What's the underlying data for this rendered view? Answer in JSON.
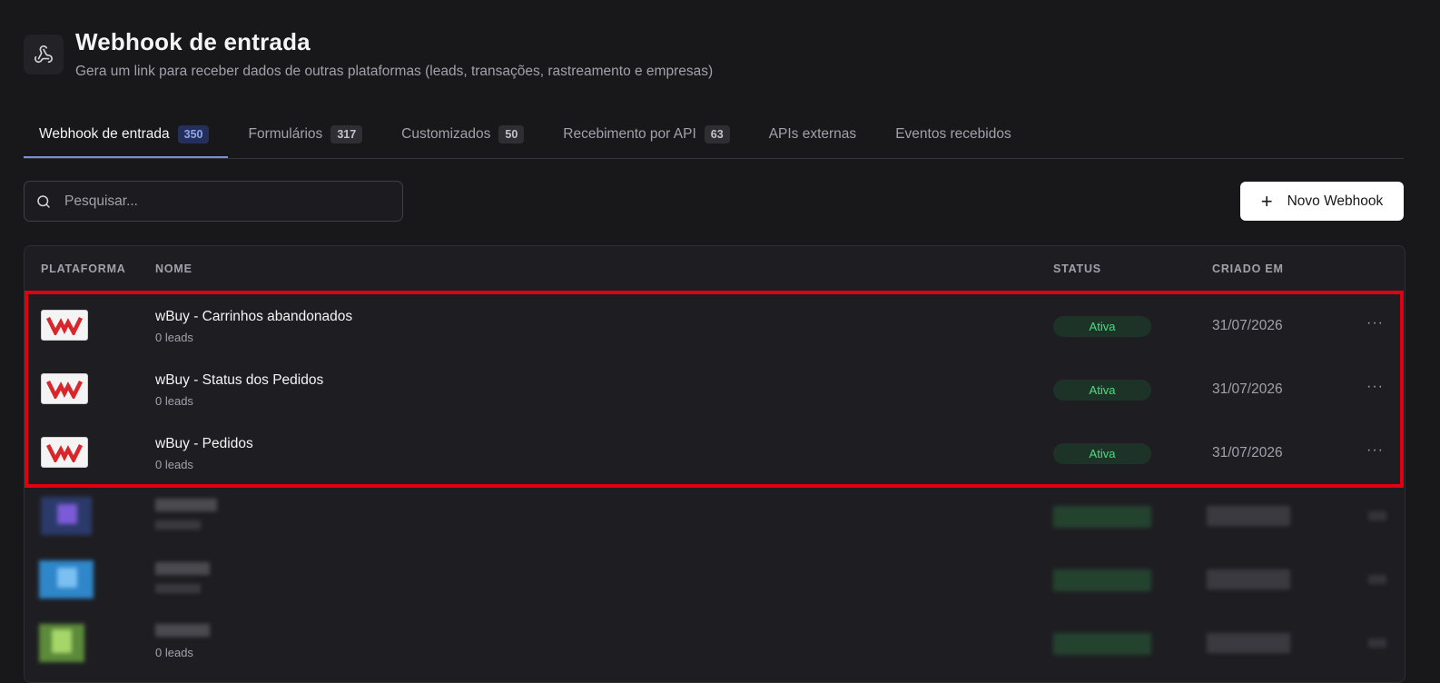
{
  "header": {
    "title": "Webhook de entrada",
    "subtitle": "Gera um link para receber dados de outras plataformas (leads, transações, rastreamento e empresas)",
    "icon": "webhook-icon"
  },
  "tabs": [
    {
      "label": "Webhook de entrada",
      "count": "350",
      "active": true
    },
    {
      "label": "Formulários",
      "count": "317"
    },
    {
      "label": "Customizados",
      "count": "50"
    },
    {
      "label": "Recebimento por API",
      "count": "63"
    },
    {
      "label": "APIs externas",
      "count": ""
    },
    {
      "label": "Eventos recebidos",
      "count": ""
    }
  ],
  "search": {
    "placeholder": "Pesquisar..."
  },
  "toolbar": {
    "new_label": "Novo Webhook"
  },
  "table": {
    "columns": {
      "platform": "PLATAFORMA",
      "name": "NOME",
      "status": "STATUS",
      "created": "CRIADO EM"
    },
    "rows": [
      {
        "platform": "wBuy",
        "name": "wBuy - Carrinhos abandonados",
        "leads": "0 leads",
        "status": "Ativa",
        "created": "31/07/2026"
      },
      {
        "platform": "wBuy",
        "name": "wBuy - Status dos Pedidos",
        "leads": "0 leads",
        "status": "Ativa",
        "created": "31/07/2026"
      },
      {
        "platform": "wBuy",
        "name": "wBuy - Pedidos",
        "leads": "0 leads",
        "status": "Ativa",
        "created": "31/07/2026"
      }
    ],
    "obscured_row_leads": "0 leads"
  },
  "colors": {
    "background": "#18181b",
    "accent_tab": "#7c90d9",
    "status_active": "#4ade80",
    "highlight": "#e00012",
    "wbuy_logo": "#d9262b"
  }
}
